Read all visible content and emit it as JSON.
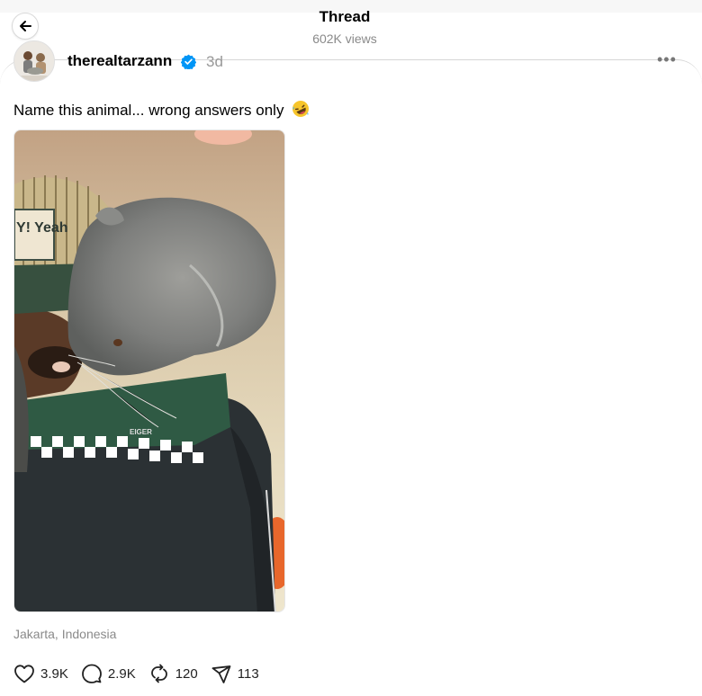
{
  "header": {
    "title": "Thread",
    "views": "602K views"
  },
  "post": {
    "username": "therealtarzann",
    "time": "3d",
    "text": "Name this animal... wrong answers only",
    "emoji_icon": "rolling-on-floor-laughing-emoji",
    "image_alt": "Man in green checkered-collar jacket holding a grey furry binturong on his shoulder",
    "image_cap_text": "Y! Yeah",
    "image_jacket_text": "EIGER",
    "location": "Jakarta, Indonesia"
  },
  "actions": {
    "likes": "3.9K",
    "replies": "2.9K",
    "reposts": "120",
    "shares": "113"
  },
  "colors": {
    "verified_blue": "#0095f6",
    "muted_gray": "#8a8a8a"
  }
}
